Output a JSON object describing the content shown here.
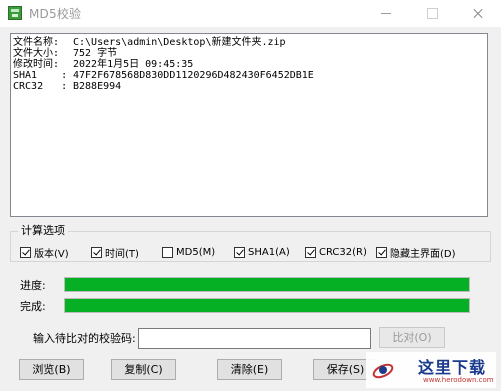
{
  "window": {
    "title": "MD5校验"
  },
  "info": {
    "lines": [
      {
        "key": "文件名称:",
        "value": "C:\\Users\\admin\\Desktop\\新建文件夹.zip"
      },
      {
        "key": "文件大小:",
        "value": "752 字节"
      },
      {
        "key": "修改时间:",
        "value": "2022年1月5日 09:45:35"
      },
      {
        "key": "SHA1    :",
        "value": "47F2F678568D830DD1120296D482430F6452DB1E"
      },
      {
        "key": "CRC32   :",
        "value": "B288E994"
      }
    ]
  },
  "options": {
    "group_title": "计算选项",
    "items": [
      {
        "label": "版本(V)",
        "checked": true
      },
      {
        "label": "时间(T)",
        "checked": true
      },
      {
        "label": "MD5(M)",
        "checked": false
      },
      {
        "label": "SHA1(A)",
        "checked": true
      },
      {
        "label": "CRC32(R)",
        "checked": true
      },
      {
        "label": "隐藏主界面(D)",
        "checked": true
      }
    ]
  },
  "progress": {
    "label": "进度:",
    "fraction": 1.0
  },
  "complete": {
    "label": "完成:",
    "fraction": 1.0
  },
  "compare": {
    "label": "输入待比对的校验码:",
    "value": "",
    "button": "比对(O)"
  },
  "buttons": {
    "browse": "浏览(B)",
    "copy": "复制(C)",
    "clear": "清除(E)",
    "save": "保存(S)"
  },
  "watermark": {
    "text": "这里下载",
    "url": "www.herodown.com"
  },
  "colors": {
    "progress_fill": "#06b025"
  }
}
